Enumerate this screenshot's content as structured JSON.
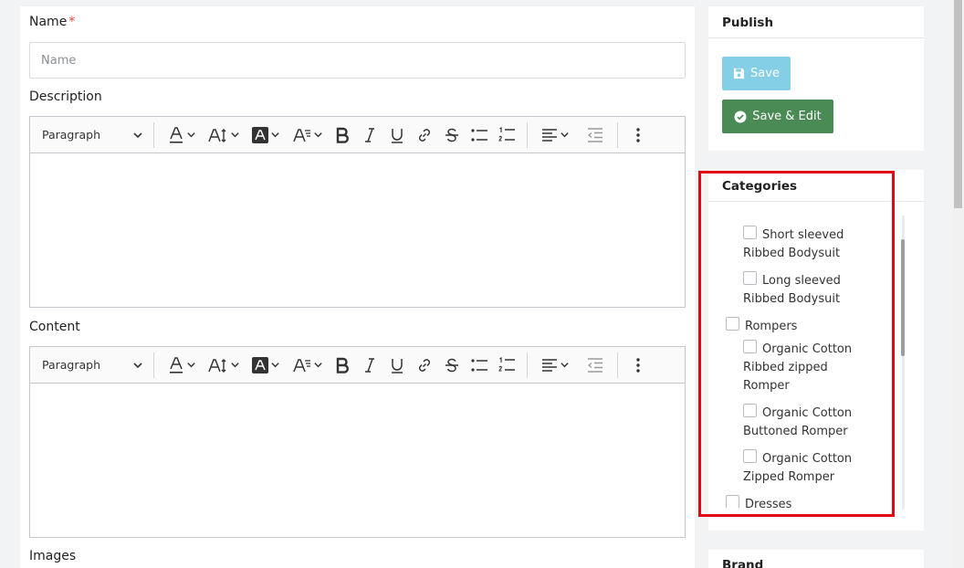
{
  "form": {
    "name_label": "Name",
    "required_mark": "*",
    "name_placeholder": "Name",
    "name_value": "",
    "description_label": "Description",
    "content_label": "Content",
    "images_label": "Images"
  },
  "editor": {
    "paragraph_label": "Paragraph"
  },
  "publish": {
    "title": "Publish",
    "save_label": "Save",
    "save_edit_label": "Save & Edit"
  },
  "categories": {
    "title": "Categories",
    "items": [
      {
        "line1": "Short sleeved",
        "line2": "Ribbed Bodysuit",
        "line3": ""
      },
      {
        "line1": "Long sleeved",
        "line2": "Ribbed Bodysuit",
        "line3": ""
      },
      {
        "line1": "Rompers",
        "line2": "",
        "line3": ""
      },
      {
        "line1": "Organic Cotton",
        "line2": "Ribbed zipped",
        "line3": "Romper"
      },
      {
        "line1": "Organic Cotton",
        "line2": "Buttoned Romper",
        "line3": ""
      },
      {
        "line1": "Organic Cotton",
        "line2": "Zipped Romper",
        "line3": ""
      },
      {
        "line1": "Dresses",
        "line2": "",
        "line3": ""
      }
    ]
  },
  "brand": {
    "title": "Brand"
  },
  "colors": {
    "accent_red": "#e30613",
    "save_blue": "#5bc0de",
    "save_edit_green": "#4a8a55"
  },
  "icons": [
    "chevron-down-icon",
    "font-color-icon",
    "font-size-icon",
    "highlight-icon",
    "font-family-icon",
    "bold-icon",
    "italic-icon",
    "underline-icon",
    "link-icon",
    "strikethrough-icon",
    "bulleted-list-icon",
    "numbered-list-icon",
    "align-icon",
    "outdent-icon",
    "more-vertical-icon",
    "floppy-disk-icon",
    "check-circle-icon"
  ]
}
